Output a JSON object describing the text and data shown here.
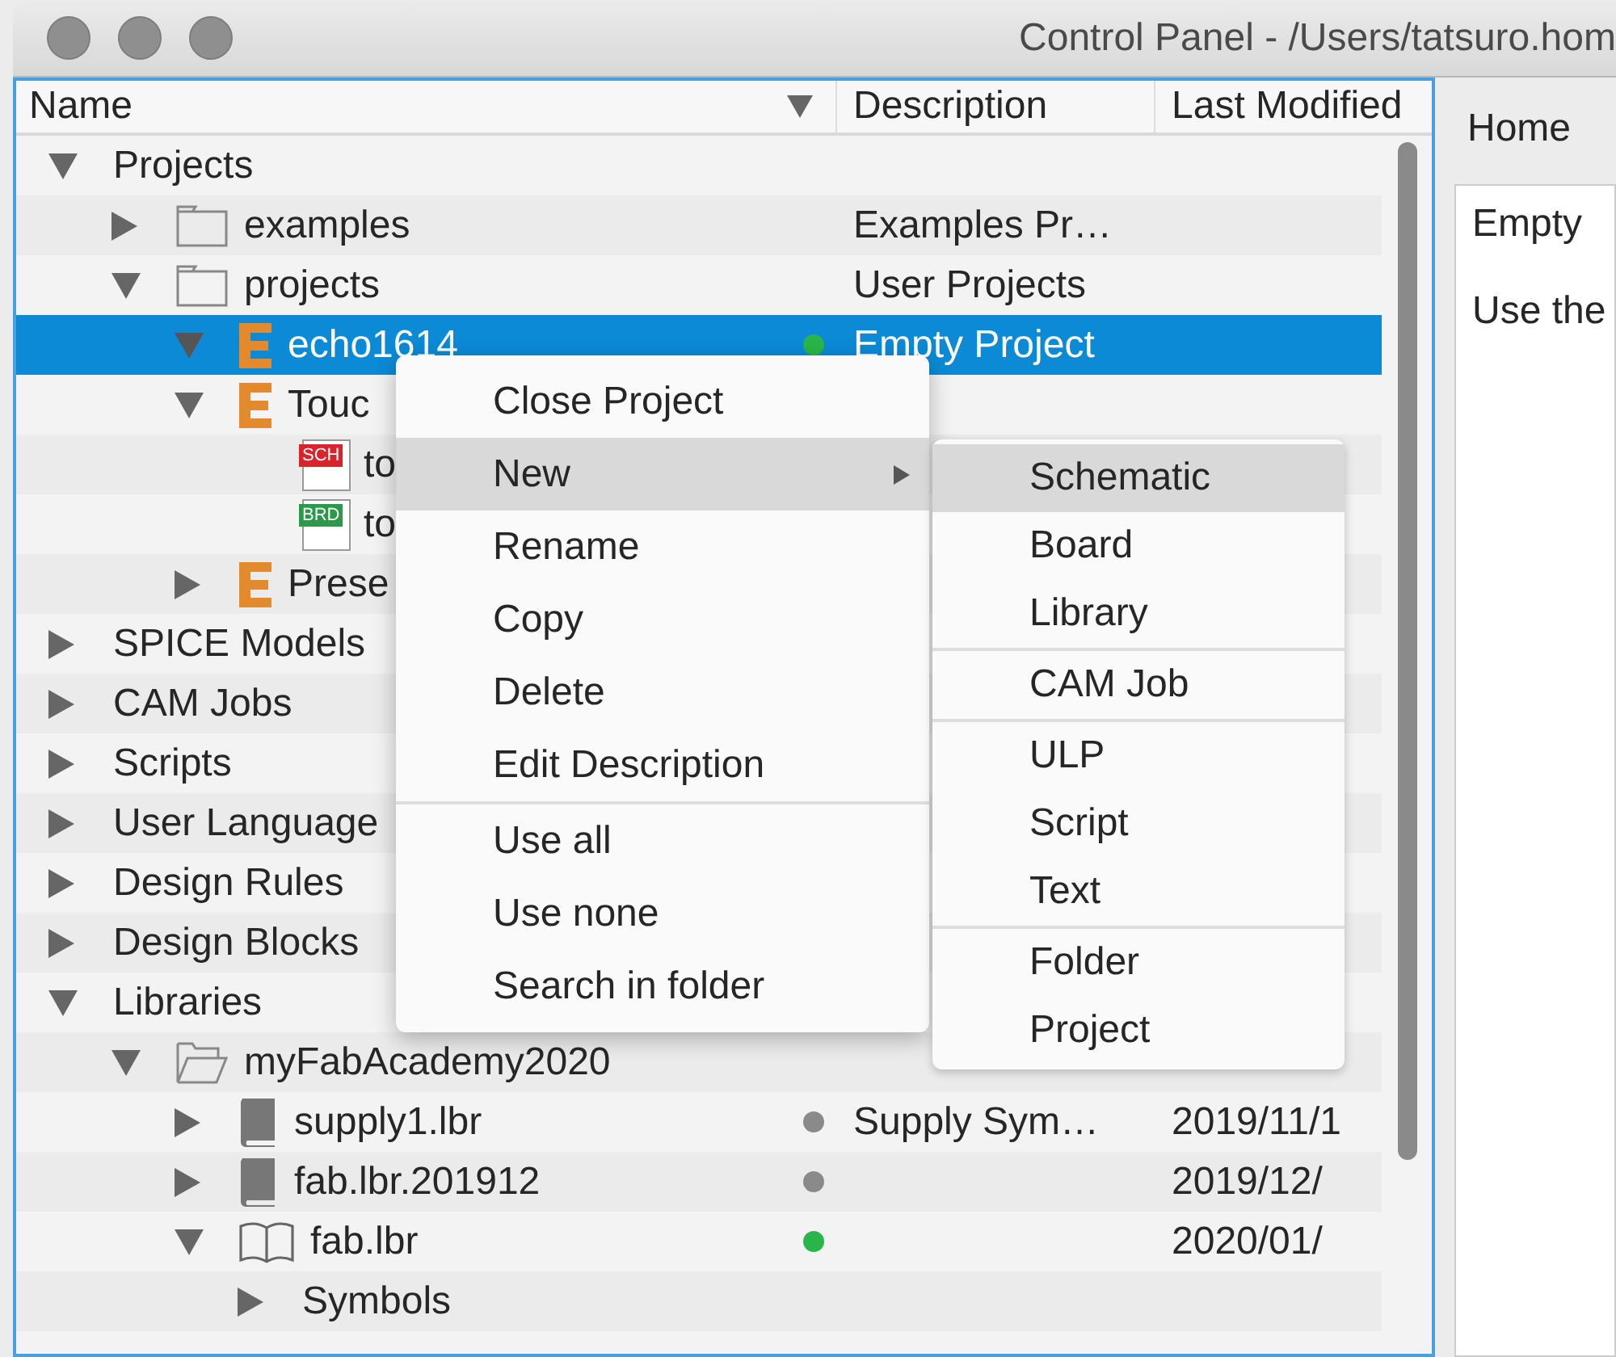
{
  "window": {
    "title": "Control Panel - /Users/tatsuro.hom"
  },
  "tree": {
    "columns": [
      {
        "label": "Name",
        "sorted": true
      },
      {
        "label": "Description"
      },
      {
        "label": "Last Modified"
      }
    ],
    "rows": [
      {
        "label": "Projects",
        "expanded": true,
        "selected": false,
        "children": [
          {
            "label": "examples",
            "kind": "folder",
            "expanded": false,
            "selected": false,
            "description": "Examples Pr…"
          },
          {
            "label": "projects",
            "kind": "folder",
            "expanded": true,
            "selected": false,
            "description": "User Projects",
            "children": [
              {
                "label": "echo1614",
                "kind": "project",
                "expanded": true,
                "selected": true,
                "dot": {
                  "color": "#2ab54a"
                },
                "description": "Empty Project"
              },
              {
                "label": "Touc",
                "kind": "project",
                "expanded": true,
                "selected": false,
                "children": [
                  {
                    "label": "to",
                    "kind": "schematic",
                    "badge": "SCH",
                    "selected": false
                  },
                  {
                    "label": "to",
                    "kind": "board",
                    "badge": "BRD",
                    "selected": false
                  }
                ]
              },
              {
                "label": "Prese",
                "kind": "project",
                "expanded": false,
                "selected": false
              }
            ]
          }
        ]
      },
      {
        "label": "SPICE Models",
        "expanded": false,
        "selected": false
      },
      {
        "label": "CAM Jobs",
        "expanded": false,
        "selected": false
      },
      {
        "label": "Scripts",
        "expanded": false,
        "selected": false
      },
      {
        "label": "User Language",
        "expanded": false,
        "selected": false
      },
      {
        "label": "Design Rules",
        "expanded": false,
        "selected": false
      },
      {
        "label": "Design Blocks",
        "expanded": false,
        "selected": false
      },
      {
        "label": "Libraries",
        "expanded": true,
        "selected": false,
        "children": [
          {
            "label": "myFabAcademy2020",
            "kind": "open-folder",
            "expanded": true,
            "selected": false,
            "children": [
              {
                "label": "supply1.lbr",
                "kind": "book",
                "expanded": false,
                "selected": false,
                "dot": {
                  "color": "#8a8a8a"
                },
                "description": "Supply Sym…",
                "modified": "2019/11/1"
              },
              {
                "label": "fab.lbr.201912",
                "kind": "book",
                "expanded": false,
                "selected": false,
                "dot": {
                  "color": "#8a8a8a"
                },
                "modified": "2019/12/"
              },
              {
                "label": "fab.lbr",
                "kind": "open-book",
                "expanded": true,
                "selected": false,
                "dot": {
                  "color": "#2ab54a"
                },
                "modified": "2020/01/",
                "children": [
                  {
                    "label": "Symbols",
                    "expanded": false,
                    "selected": false
                  }
                ]
              }
            ]
          }
        ]
      }
    ]
  },
  "context_menu": {
    "sections": [
      [
        {
          "label": "Close Project",
          "selected": false,
          "has_submenu": false
        },
        {
          "label": "New",
          "selected": true,
          "has_submenu": true
        },
        {
          "label": "Rename",
          "selected": false,
          "has_submenu": false
        },
        {
          "label": "Copy",
          "selected": false,
          "has_submenu": false
        },
        {
          "label": "Delete",
          "selected": false,
          "has_submenu": false
        },
        {
          "label": "Edit Description",
          "selected": false,
          "has_submenu": false
        }
      ],
      [
        {
          "label": "Use all",
          "selected": false,
          "has_submenu": false
        },
        {
          "label": "Use none",
          "selected": false,
          "has_submenu": false
        },
        {
          "label": "Search in folder",
          "selected": false,
          "has_submenu": false
        }
      ]
    ]
  },
  "submenu": {
    "sections": [
      [
        {
          "label": "Schematic",
          "selected": true
        },
        {
          "label": "Board",
          "selected": false
        },
        {
          "label": "Library",
          "selected": false
        }
      ],
      [
        {
          "label": "CAM Job",
          "selected": false
        }
      ],
      [
        {
          "label": "ULP",
          "selected": false
        },
        {
          "label": "Script",
          "selected": false
        },
        {
          "label": "Text",
          "selected": false
        }
      ],
      [
        {
          "label": "Folder",
          "selected": false
        },
        {
          "label": "Project",
          "selected": false
        }
      ]
    ]
  },
  "side_panel": {
    "tabs": [
      {
        "label": "Home",
        "selected": true
      }
    ],
    "lines": [
      "Empty",
      "Use the"
    ]
  }
}
